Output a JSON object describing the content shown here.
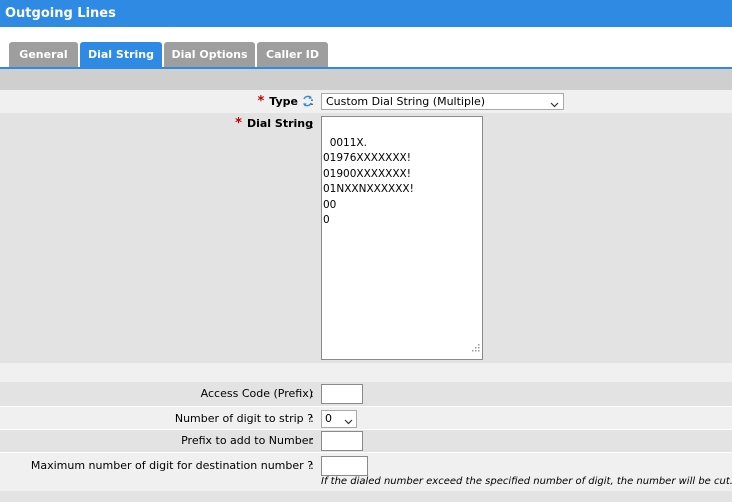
{
  "window": {
    "title": "Outgoing Lines"
  },
  "tabs": [
    {
      "label": "General"
    },
    {
      "label": "Dial String"
    },
    {
      "label": "Dial Options"
    },
    {
      "label": "Caller ID"
    }
  ],
  "form": {
    "type": {
      "label": "Type",
      "value": "Custom Dial String (Multiple)"
    },
    "dial_string": {
      "label": "Dial String",
      "value": "0011X.\n01976XXXXXXX!\n01900XXXXXXX!\n01NXXNXXXXXX!\n00\n0"
    },
    "access_code": {
      "label": "Access Code (Prefix)",
      "value": ""
    },
    "digit_strip": {
      "label": "Number of digit to strip ?",
      "value": "0"
    },
    "prefix_add": {
      "label": "Prefix to add to Number",
      "value": ""
    },
    "max_digits": {
      "label": "Maximum number of digit for destination number ?",
      "value": "",
      "hint": "If the dialed number exceed the specified number of digit, the number will be cut."
    }
  },
  "symbols": {
    "required": "*",
    "colon": ":"
  },
  "colors": {
    "accent": "#2f8ae3",
    "tab_inactive": "#9e9e9e",
    "required": "#c00000",
    "band": "#e3e3e3"
  },
  "icons": [
    "refresh-icon",
    "chevron-down-icon",
    "resize-grip-icon"
  ]
}
